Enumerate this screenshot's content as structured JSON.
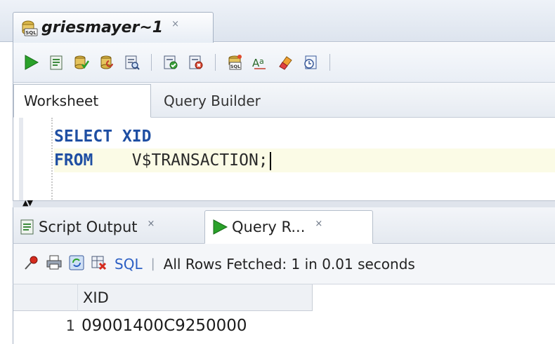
{
  "doc_tab": {
    "title": "griesmayer~1",
    "close_glyph": "×",
    "icon": "sql-worksheet-icon"
  },
  "toolbar": {
    "buttons": [
      {
        "icon": "run-statement-icon"
      },
      {
        "icon": "run-script-icon"
      },
      {
        "icon": "commit-icon"
      },
      {
        "icon": "rollback-icon"
      },
      {
        "icon": "explain-plan-icon"
      },
      {
        "icon": "autotrace-icon"
      },
      {
        "icon": "sql-tuning-icon"
      },
      {
        "icon": "unshared-worksheet-icon"
      },
      {
        "icon": "format-case-icon"
      },
      {
        "icon": "clear-eraser-icon"
      },
      {
        "icon": "sql-history-icon"
      }
    ]
  },
  "worksheet_tabs": {
    "worksheet": "Worksheet",
    "query_builder": "Query Builder"
  },
  "editor": {
    "line1_kw1": "SELECT",
    "line1_text": "XID",
    "line2_kw1": "FROM",
    "line2_text": "V$TRANSACTION;"
  },
  "splitter": {
    "arrows": "▲▼"
  },
  "output_tabs": {
    "script_output": "Script Output",
    "query_result": "Query R...",
    "close_glyph": "×"
  },
  "results_toolbar": {
    "sql_label": "SQL",
    "separator": "|",
    "status": "All Rows Fetched: 1 in 0.01 seconds"
  },
  "grid": {
    "columns": [
      "XID"
    ],
    "rows": [
      {
        "rownum": "1",
        "values": [
          "09001400C9250000"
        ]
      }
    ]
  },
  "colors": {
    "keyword": "#1f4fa3",
    "run_green": "#2aa12a",
    "sql_link": "#2c5fc4",
    "current_line": "#fbfbe6"
  }
}
